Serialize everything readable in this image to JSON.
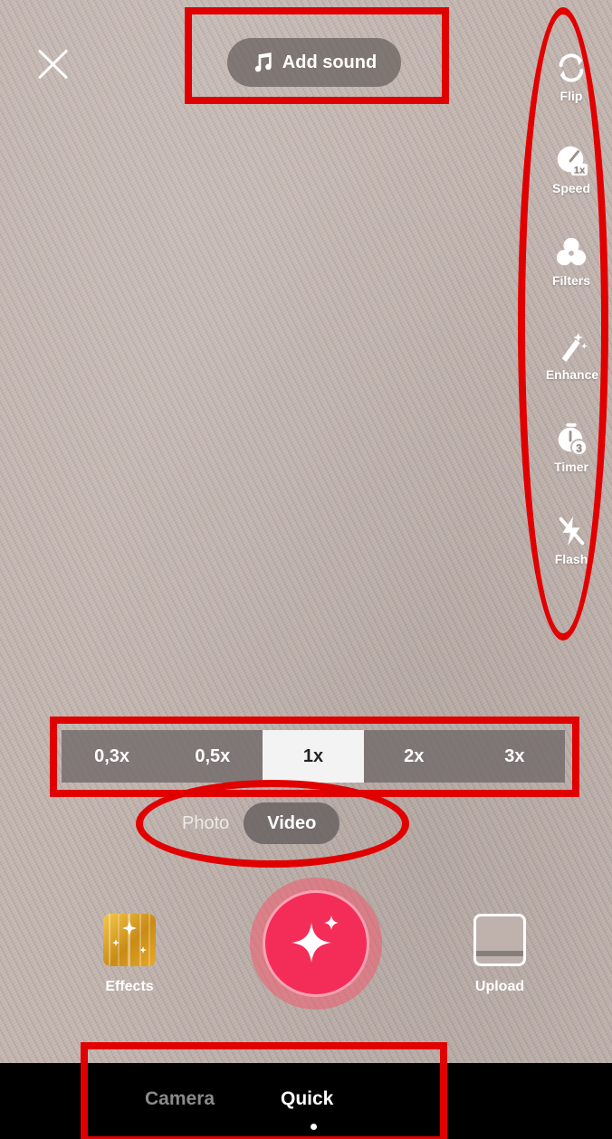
{
  "top_bar": {
    "close_icon": "close-icon",
    "add_sound_label": "Add sound",
    "add_sound_icon": "music-note-icon"
  },
  "side_tools": [
    {
      "label": "Flip",
      "icon": "flip-camera-icon"
    },
    {
      "label": "Speed",
      "icon": "speed-gauge-icon",
      "badge": "1x"
    },
    {
      "label": "Filters",
      "icon": "filters-icon"
    },
    {
      "label": "Enhance",
      "icon": "magic-wand-icon"
    },
    {
      "label": "Timer",
      "icon": "timer-icon",
      "badge": "3"
    },
    {
      "label": "Flash",
      "icon": "flash-off-icon"
    }
  ],
  "zoom": {
    "options": [
      "0,3x",
      "0,5x",
      "1x",
      "2x",
      "3x"
    ],
    "selected": "1x"
  },
  "mode": {
    "photo_label": "Photo",
    "video_label": "Video",
    "selected": "Video"
  },
  "capture": {
    "effects_label": "Effects",
    "upload_label": "Upload",
    "shutter_icon": "sparkle-icon"
  },
  "bottom_nav": {
    "items": [
      "Camera",
      "Quick"
    ],
    "selected": "Quick"
  },
  "colors": {
    "shutter": "#f42d58",
    "annotation": "#e10000",
    "wall": "#c3b5af"
  }
}
